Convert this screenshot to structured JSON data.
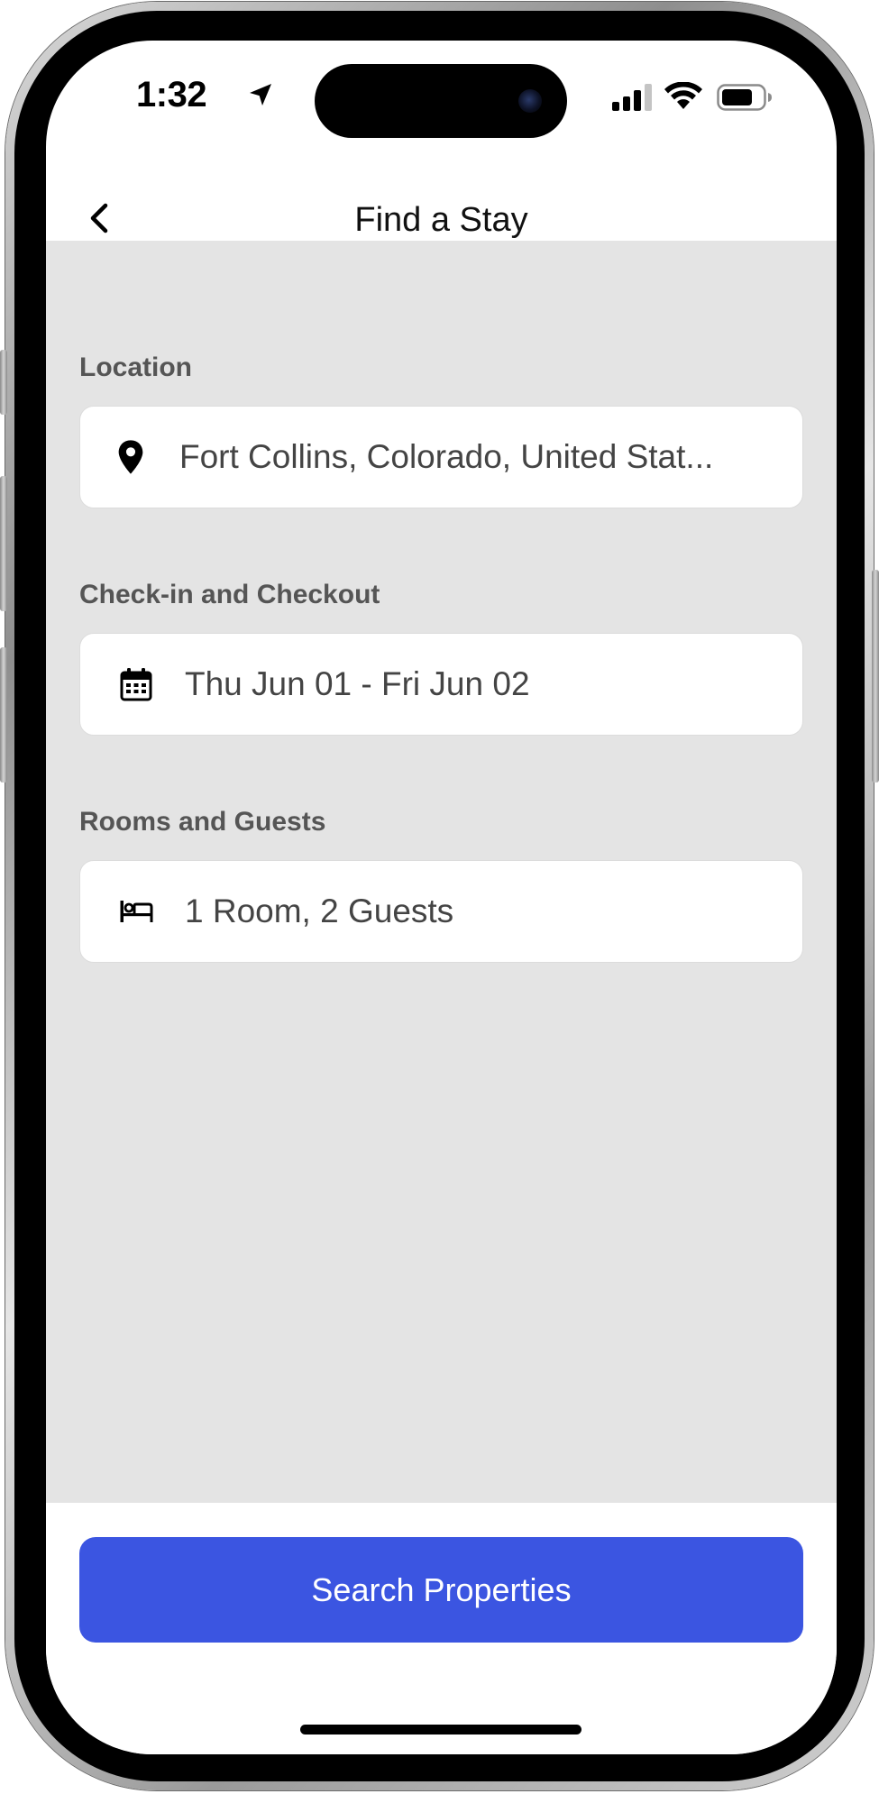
{
  "status_bar": {
    "time": "1:32",
    "location_icon": "location-arrow-icon",
    "signal_icon": "cellular-signal-icon",
    "wifi_icon": "wifi-icon",
    "battery_icon": "battery-icon"
  },
  "navbar": {
    "title": "Find a Stay",
    "back_icon": "chevron-left-icon"
  },
  "form": {
    "location": {
      "label": "Location",
      "value": "Fort Collins, Colorado, United Stat...",
      "icon": "map-pin-icon"
    },
    "dates": {
      "label": "Check-in and Checkout",
      "value": "Thu Jun 01 - Fri Jun 02",
      "icon": "calendar-icon"
    },
    "rooms": {
      "label": "Rooms and Guests",
      "value": "1 Room, 2 Guests",
      "icon": "bed-icon"
    }
  },
  "actions": {
    "search_label": "Search Properties"
  },
  "colors": {
    "primary": "#3b55e1",
    "background": "#e4e4e4",
    "label": "#555555"
  }
}
